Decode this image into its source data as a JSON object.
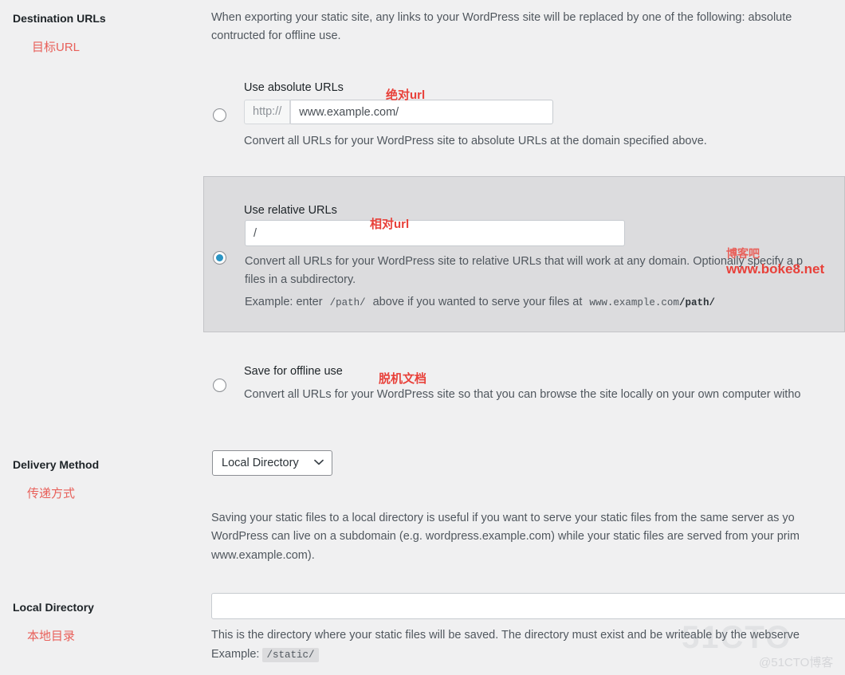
{
  "sections": {
    "destination_urls": {
      "label": "Destination URLs",
      "cn_note": "目标URL",
      "intro": "When exporting your static site, any links to your WordPress site will be replaced by one of the following: absolute",
      "intro_line2": "contructed for offline use."
    },
    "delivery_method": {
      "label": "Delivery Method",
      "cn_note": "传递方式",
      "selected": "Local Directory",
      "chevron": "chevron-down-icon",
      "desc_line1": "Saving your static files to a local directory is useful if you want to serve your static files from the same server as yo",
      "desc_line2": "WordPress can live on a subdomain (e.g. wordpress.example.com) while your static files are served from your prim",
      "desc_line3": "www.example.com)."
    },
    "local_directory": {
      "label": "Local Directory",
      "cn_note": "本地目录",
      "value": "",
      "placeholder": "",
      "desc": "This is the directory where your static files will be saved. The directory must exist and be writeable by the webserve",
      "example_label": "Example:",
      "example_value": "/static/"
    }
  },
  "options": [
    {
      "id": "absolute",
      "title": "Use absolute URLs",
      "cn_note": "绝对url",
      "selected": false,
      "prefix": "http://",
      "value": "www.example.com/",
      "desc": "Convert all URLs for your WordPress site to absolute URLs at the domain specified above."
    },
    {
      "id": "relative",
      "title": "Use relative URLs",
      "cn_note": "相对url",
      "selected": true,
      "value": "/",
      "desc_line1": "Convert all URLs for your WordPress site to relative URLs that will work at any domain. Optionally specify a p",
      "desc_line2": "files in a subdirectory.",
      "example_prefix": "Example: enter",
      "example_code": "/path/",
      "example_mid": "above if you wanted to serve your files at",
      "example_code2_plain": "www.example.com",
      "example_code2_bold": "/path/"
    },
    {
      "id": "offline",
      "title": "Save for offline use",
      "cn_note": "脱机文档",
      "selected": false,
      "desc": "Convert all URLs for your WordPress site so that you can browse the site locally on your own computer witho"
    }
  ],
  "annotations": {
    "site_cn": "博客吧",
    "site_url": "www.boke8.net"
  },
  "watermark": {
    "logo": "51CTO",
    "text": "@51CTO博客"
  },
  "colors": {
    "accent": "#2b95c4",
    "annotation_red": "#e8413a",
    "page_bg": "#f0f0f1",
    "highlight_bg": "#dcdcde"
  }
}
